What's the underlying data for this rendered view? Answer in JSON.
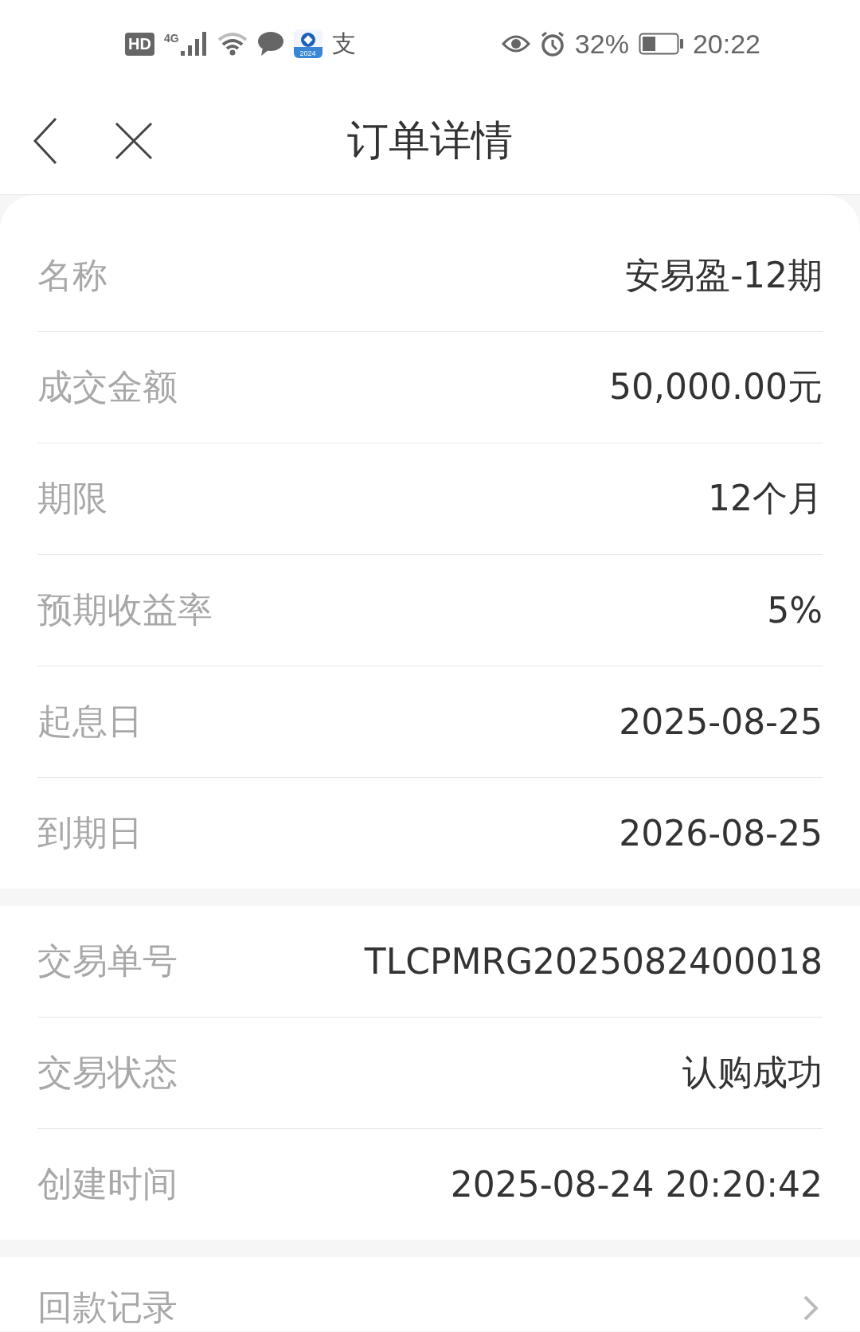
{
  "status_bar": {
    "hd_badge": "HD",
    "network_type": "4G",
    "app_badge": "2024",
    "app_glyph": "支",
    "battery_percent": "32%",
    "time": "20:22"
  },
  "header": {
    "title": "订单详情"
  },
  "sections": [
    {
      "rows": [
        {
          "kind": "info",
          "label": "名称",
          "value": "安易盈-12期"
        },
        {
          "kind": "info",
          "label": "成交金额",
          "value": "50,000.00元"
        },
        {
          "kind": "info",
          "label": "期限",
          "value": "12个月"
        },
        {
          "kind": "info",
          "label": "预期收益率",
          "value": "5%"
        },
        {
          "kind": "info",
          "label": "起息日",
          "value": "2025-08-25"
        },
        {
          "kind": "info",
          "label": "到期日",
          "value": "2026-08-25"
        }
      ]
    },
    {
      "rows": [
        {
          "kind": "info",
          "label": "交易单号",
          "value": "TLCPMRG2025082400018"
        },
        {
          "kind": "info",
          "label": "交易状态",
          "value": "认购成功"
        },
        {
          "kind": "info",
          "label": "创建时间",
          "value": "2025-08-24 20:20:42"
        }
      ]
    },
    {
      "rows": [
        {
          "kind": "link",
          "label": "回款记录"
        }
      ]
    }
  ]
}
